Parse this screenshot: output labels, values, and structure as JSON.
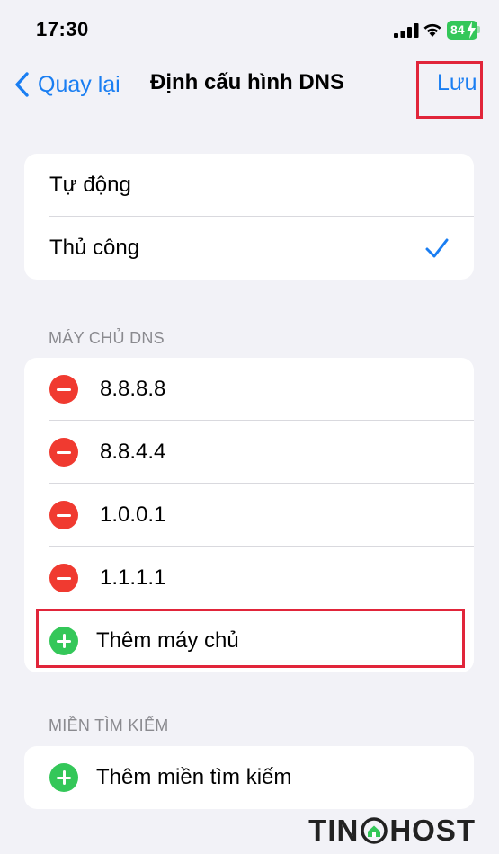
{
  "status_bar": {
    "time": "17:30",
    "battery": "84"
  },
  "nav": {
    "back_label": "Quay lại",
    "title": "Định cấu hình DNS",
    "save_label": "Lưu"
  },
  "mode": {
    "options": [
      {
        "label": "Tự động",
        "selected": false
      },
      {
        "label": "Thủ công",
        "selected": true
      }
    ]
  },
  "dns": {
    "header": "MÁY CHỦ DNS",
    "servers": [
      "8.8.8.8",
      "8.8.4.4",
      "1.0.0.1",
      "1.1.1.1"
    ],
    "add_label": "Thêm máy chủ"
  },
  "search_domains": {
    "header": "MIỀN TÌM KIẾM",
    "add_label": "Thêm miền tìm kiếm"
  },
  "watermark": {
    "left": "TIN",
    "right": "HOST"
  },
  "colors": {
    "accent": "#1a7ef2",
    "delete": "#f03a30",
    "add": "#34c759",
    "highlight": "#e1253a"
  },
  "icons": [
    "signal-icon",
    "wifi-icon",
    "battery-icon",
    "chevron-left-icon",
    "checkmark-icon",
    "minus-circle-icon",
    "plus-circle-icon"
  ]
}
